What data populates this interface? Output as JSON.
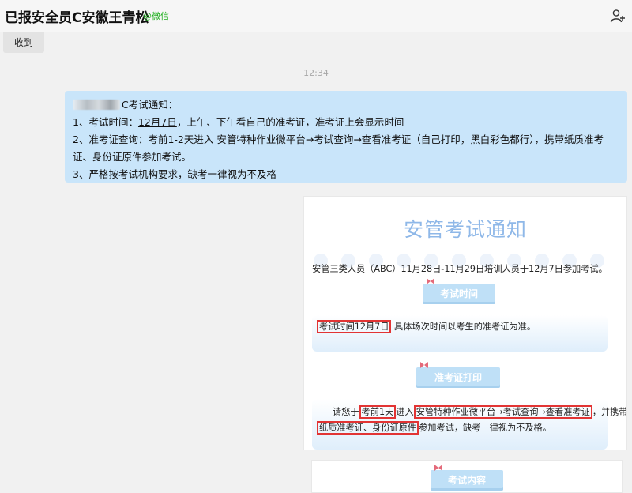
{
  "header": {
    "title": "已报安全员C安徽王青松",
    "badge": "@微信",
    "add_icon": "add-user-icon"
  },
  "chip": {
    "label": "收到"
  },
  "timestamp": "12:34",
  "message": {
    "line1_suffix": "C考试通知：",
    "line2_prefix": "1、考试时间：",
    "line2_date": "12月7日",
    "line2_suffix": "，上午、下午看自己的准考证，准考证上会显示时间",
    "line3": "2、准考证查询：考前1-2天进入 安管特种作业微平台→考试查询→查看准考证（自己打印，黑白彩色都行），携带纸质准考证、身份证原件参加考试。",
    "line4": "3、严格按考试机构要求，缺考一律视为不及格"
  },
  "poster": {
    "title": "安管考试通知",
    "intro": "安管三类人员（ABC）11月28日-11月29日培训人员于12月7日参加考试。",
    "ribbon1": "考试时间",
    "time_highlight": "考试时间12月7日",
    "time_rest": " 具体场次时间以考生的准考证为准。",
    "ribbon2": "准考证打印",
    "print_a": "请您于",
    "print_hl1": "考前1天",
    "print_b": "进入",
    "print_hl2": "安管特种作业微平台→考试查询→查看准考证",
    "print_c": "，并携带",
    "print_hl3": "纸质准考证、身份证原件",
    "print_d": "参加考试，缺考一律视为不及格。",
    "ribbon3": "考试内容"
  },
  "colors": {
    "bubble": "#c9e5fa",
    "highlight": "#e23434",
    "ribbon": "#bfe0f7",
    "wechat_green": "#1aad19"
  }
}
